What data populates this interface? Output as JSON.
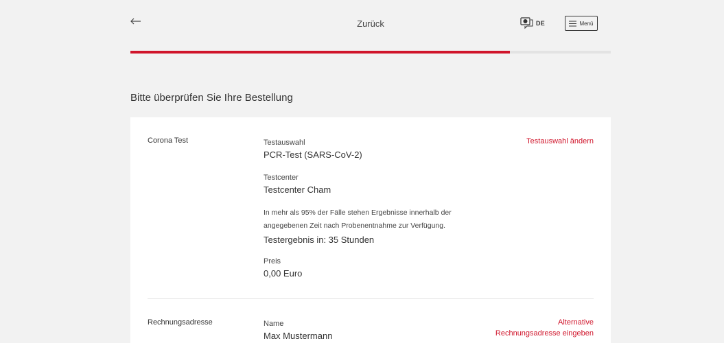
{
  "header": {
    "title": "Zurück",
    "language": "DE",
    "menu_label": "Menü"
  },
  "progress": {
    "fraction": 0.79,
    "accent_color": "#d0152b"
  },
  "page_heading": "Bitte überprüfen Sie Ihre Bestellung",
  "order": {
    "section_label": "Corona Test",
    "change_link": "Testauswahl ändern",
    "test_selection_label": "Testauswahl",
    "test_selection_value": "PCR-Test (SARS-CoV-2)",
    "testcenter_label": "Testcenter",
    "testcenter_value": "Testcenter Cham",
    "note": "In mehr als 95% der Fälle stehen Ergebnisse innerhalb der angegebenen Zeit nach Probenentnahme zur Verfügung.",
    "result_time": "Testergebnis in: 35 Stunden",
    "price_label": "Preis",
    "price_value": "0,00 Euro"
  },
  "billing": {
    "section_label": "Rechnungsadresse",
    "alt_link_line1": "Alternative",
    "alt_link_line2": "Rechnungsadresse eingeben",
    "name_label": "Name",
    "name_value": "Max Mustermann"
  },
  "icons": {
    "back": "arrow-left-icon",
    "language": "speech-bubble-icon",
    "menu": "hamburger-icon"
  }
}
